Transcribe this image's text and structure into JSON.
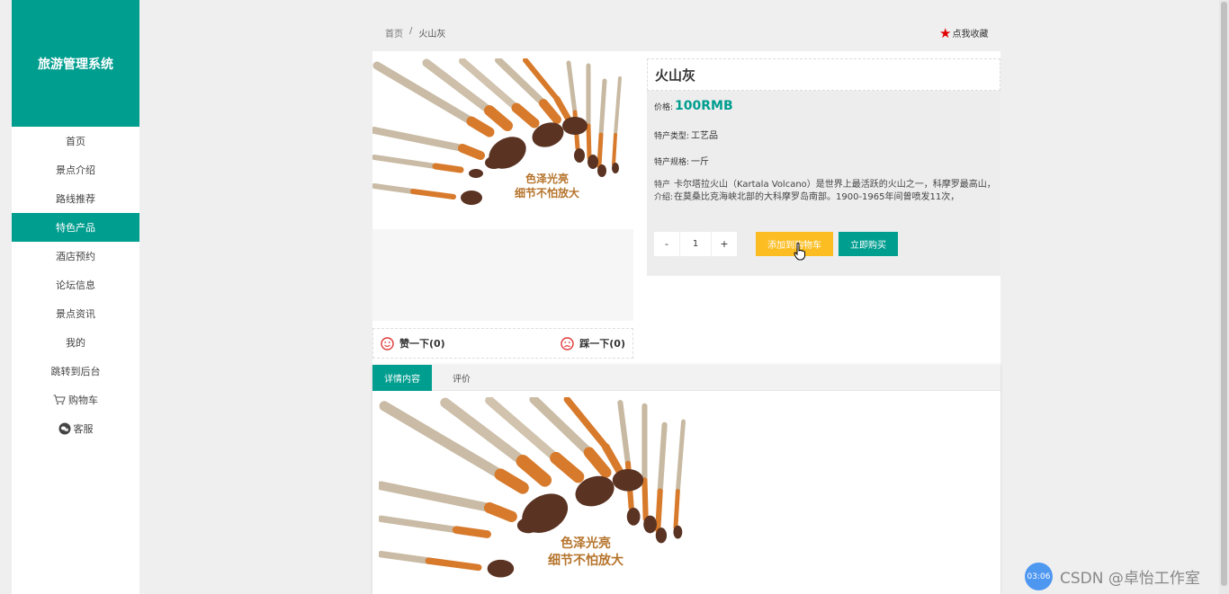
{
  "app": {
    "brand": "旅游管理系统"
  },
  "sidebar": {
    "items": [
      {
        "label": "首页",
        "icon": ""
      },
      {
        "label": "景点介绍",
        "icon": ""
      },
      {
        "label": "路线推荐",
        "icon": ""
      },
      {
        "label": "特色产品",
        "icon": "",
        "active": true
      },
      {
        "label": "酒店预约",
        "icon": ""
      },
      {
        "label": "论坛信息",
        "icon": ""
      },
      {
        "label": "景点资讯",
        "icon": ""
      },
      {
        "label": "我的",
        "icon": ""
      },
      {
        "label": "跳转到后台",
        "icon": ""
      },
      {
        "label": "购物车",
        "icon": "cart-icon"
      },
      {
        "label": "客服",
        "icon": "chat-icon"
      }
    ]
  },
  "breadcrumb": {
    "home": "首页",
    "separator": "/",
    "current": "火山灰"
  },
  "favorite": {
    "label": "点我收藏",
    "icon": "star-icon",
    "color": "#e00000"
  },
  "product": {
    "title": "火山灰",
    "price_label": "价格:",
    "price_value": "100RMB",
    "type_label": "特产类型:",
    "type_value": "工艺品",
    "spec_label": "特产规格:",
    "spec_value": "一斤",
    "desc_label": "特产介绍:",
    "desc_value": "卡尔塔拉火山（Kartala Volcano）是世界上最活跃的火山之一，科摩罗最高山，在莫桑比克海峡北部的大科摩罗岛南部。1900-1965年间曾喷发11次，",
    "image_caption_line1": "色泽光亮",
    "image_caption_line2": "细节不怕放大"
  },
  "quantity": {
    "minus": "-",
    "value": "1",
    "plus": "+"
  },
  "actions": {
    "add_to_cart": "添加到购物车",
    "buy_now": "立即购买"
  },
  "votes": {
    "like_label": "赞一下(0)",
    "dislike_label": "踩一下(0)",
    "icon": "smiley-icon"
  },
  "tabs": [
    {
      "label": "详情内容",
      "active": true
    },
    {
      "label": "评价"
    }
  ],
  "watermark": {
    "time": "03:06",
    "text": "CSDN @卓怡工作室"
  },
  "colors": {
    "accent": "#009e8f",
    "cart_button": "#fbbd22",
    "background": "#efeff0"
  }
}
